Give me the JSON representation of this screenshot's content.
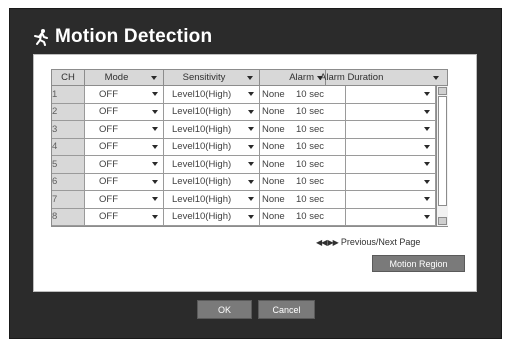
{
  "dialog": {
    "title": "Motion Detection",
    "icon": "running-person-icon"
  },
  "table": {
    "headers": {
      "ch": "CH",
      "mode": "Mode",
      "sensitivity": "Sensitivity",
      "alarm": "Alarm",
      "alarm_duration": "Alarm Duration"
    },
    "rows": [
      {
        "ch": "1",
        "mode": "OFF",
        "sensitivity": "Level10(High)",
        "alarm": "None",
        "duration": "10 sec"
      },
      {
        "ch": "2",
        "mode": "OFF",
        "sensitivity": "Level10(High)",
        "alarm": "None",
        "duration": "10 sec"
      },
      {
        "ch": "3",
        "mode": "OFF",
        "sensitivity": "Level10(High)",
        "alarm": "None",
        "duration": "10 sec"
      },
      {
        "ch": "4",
        "mode": "OFF",
        "sensitivity": "Level10(High)",
        "alarm": "None",
        "duration": "10 sec"
      },
      {
        "ch": "5",
        "mode": "OFF",
        "sensitivity": "Level10(High)",
        "alarm": "None",
        "duration": "10 sec"
      },
      {
        "ch": "6",
        "mode": "OFF",
        "sensitivity": "Level10(High)",
        "alarm": "None",
        "duration": "10 sec"
      },
      {
        "ch": "7",
        "mode": "OFF",
        "sensitivity": "Level10(High)",
        "alarm": "None",
        "duration": "10 sec"
      },
      {
        "ch": "8",
        "mode": "OFF",
        "sensitivity": "Level10(High)",
        "alarm": "None",
        "duration": "10 sec"
      }
    ]
  },
  "pager": {
    "arrows": "◀◀ ▶▶",
    "label": "Previous/Next Page"
  },
  "buttons": {
    "motion_region": "Motion Region",
    "ok": "OK",
    "cancel": "Cancel"
  },
  "colors": {
    "frame": "#2b2b2b",
    "header_bg": "#d8d8d8",
    "button_bg": "#7a7a7a"
  }
}
